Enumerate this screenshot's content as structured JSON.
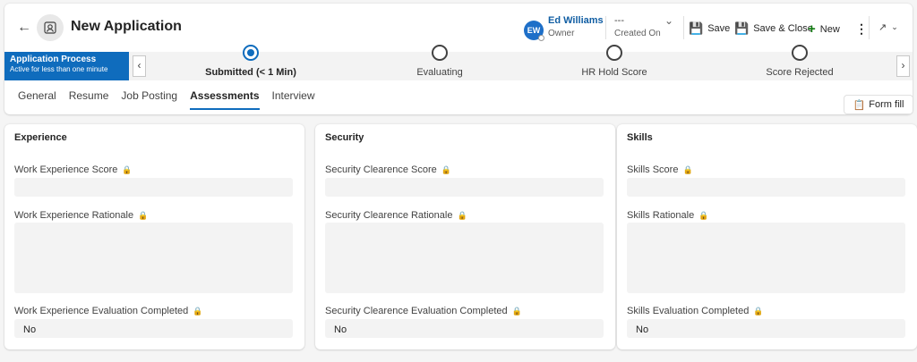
{
  "header": {
    "title": "New Application",
    "owner_initials": "EW",
    "owner_name": "Ed Williams",
    "owner_label": "Owner",
    "created_value": "---",
    "created_label": "Created On"
  },
  "commands": {
    "save": "Save",
    "save_close": "Save & Close",
    "new": "New"
  },
  "process": {
    "name": "Application Process",
    "status": "Active for less than one minute",
    "stages": [
      {
        "label": "Submitted  (< 1 Min)",
        "active": true
      },
      {
        "label": "Evaluating",
        "active": false
      },
      {
        "label": "HR Hold Score",
        "active": false
      },
      {
        "label": "Score Rejected",
        "active": false
      }
    ]
  },
  "tabs": [
    "General",
    "Resume",
    "Job Posting",
    "Assessments",
    "Interview"
  ],
  "active_tab": "Assessments",
  "form_fill": "Form fill",
  "sections": [
    {
      "title": "Experience",
      "score_label": "Work Experience Score",
      "rationale_label": "Work Experience Rationale",
      "completed_label": "Work Experience Evaluation Completed",
      "completed_value": "No"
    },
    {
      "title": "Security",
      "score_label": "Security Clearence Score",
      "rationale_label": "Security Clearence Rationale",
      "completed_label": "Security Clearence Evaluation Completed",
      "completed_value": "No"
    },
    {
      "title": "Skills",
      "score_label": "Skills Score",
      "rationale_label": "Skills Rationale",
      "completed_label": "Skills Evaluation Completed",
      "completed_value": "No"
    }
  ],
  "colors": {
    "accent": "#0f6cbd",
    "command_icon": "#9b1fa8",
    "new_icon": "#107c10"
  }
}
